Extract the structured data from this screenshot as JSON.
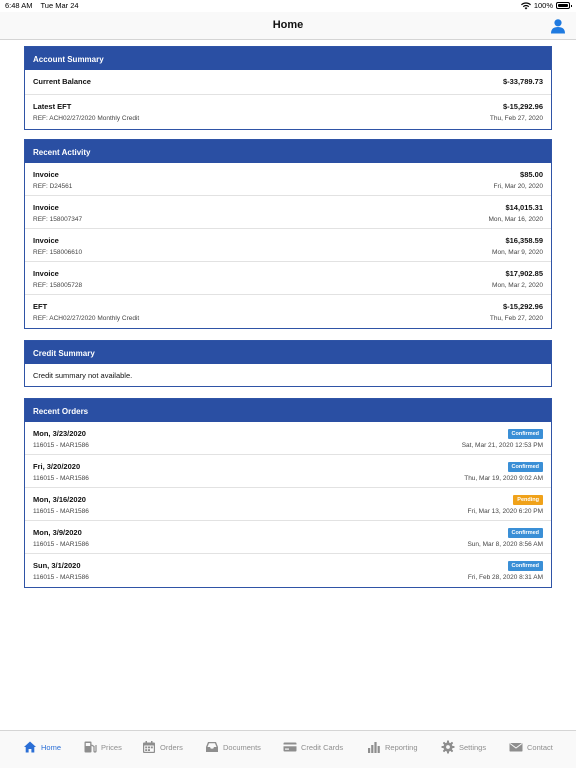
{
  "status_bar": {
    "time": "6:48 AM",
    "date": "Tue Mar 24",
    "battery": "100%"
  },
  "nav": {
    "title": "Home"
  },
  "account_summary": {
    "header": "Account Summary",
    "rows": [
      {
        "title": "Current Balance",
        "amount": "$-33,789.73"
      },
      {
        "title": "Latest EFT",
        "ref": "REF: ACH02/27/2020 Monthly Credit",
        "amount": "$-15,292.96",
        "date": "Thu, Feb 27, 2020"
      }
    ]
  },
  "recent_activity": {
    "header": "Recent Activity",
    "rows": [
      {
        "title": "Invoice",
        "ref": "REF: D24561",
        "amount": "$85.00",
        "date": "Fri, Mar 20, 2020"
      },
      {
        "title": "Invoice",
        "ref": "REF: 158007347",
        "amount": "$14,015.31",
        "date": "Mon, Mar 16, 2020"
      },
      {
        "title": "Invoice",
        "ref": "REF: 158006610",
        "amount": "$16,358.59",
        "date": "Mon, Mar 9, 2020"
      },
      {
        "title": "Invoice",
        "ref": "REF: 158005728",
        "amount": "$17,902.85",
        "date": "Mon, Mar 2, 2020"
      },
      {
        "title": "EFT",
        "ref": "REF: ACH02/27/2020 Monthly Credit",
        "amount": "$-15,292.96",
        "date": "Thu, Feb 27, 2020"
      }
    ]
  },
  "credit_summary": {
    "header": "Credit Summary",
    "message": "Credit summary not available."
  },
  "recent_orders": {
    "header": "Recent Orders",
    "rows": [
      {
        "title": "Mon, 3/23/2020",
        "ref": "116015 - MAR1586",
        "status": "Confirmed",
        "date": "Sat, Mar 21, 2020 12:53 PM"
      },
      {
        "title": "Fri, 3/20/2020",
        "ref": "116015 - MAR1586",
        "status": "Confirmed",
        "date": "Thu, Mar 19, 2020 9:02 AM"
      },
      {
        "title": "Mon, 3/16/2020",
        "ref": "116015 - MAR1586",
        "status": "Pending",
        "date": "Fri, Mar 13, 2020 6:20 PM"
      },
      {
        "title": "Mon, 3/9/2020",
        "ref": "116015 - MAR1586",
        "status": "Confirmed",
        "date": "Sun, Mar 8, 2020 8:56 AM"
      },
      {
        "title": "Sun, 3/1/2020",
        "ref": "116015 - MAR1586",
        "status": "Confirmed",
        "date": "Fri, Feb 28, 2020 8:31 AM"
      }
    ]
  },
  "tabs": [
    {
      "label": "Home",
      "icon": "home-icon",
      "active": true
    },
    {
      "label": "Prices",
      "icon": "fuel-pump-icon"
    },
    {
      "label": "Orders",
      "icon": "calendar-icon"
    },
    {
      "label": "Documents",
      "icon": "inbox-tray-icon"
    },
    {
      "label": "Credit Cards",
      "icon": "credit-card-icon"
    },
    {
      "label": "Reporting",
      "icon": "bar-chart-icon"
    },
    {
      "label": "Settings",
      "icon": "gear-icon"
    },
    {
      "label": "Contact",
      "icon": "envelope-icon"
    }
  ],
  "colors": {
    "header_blue": "#2a4fa3",
    "confirmed": "#3a8fd6",
    "pending": "#f0a21a",
    "active_tab": "#2b6fd6"
  }
}
